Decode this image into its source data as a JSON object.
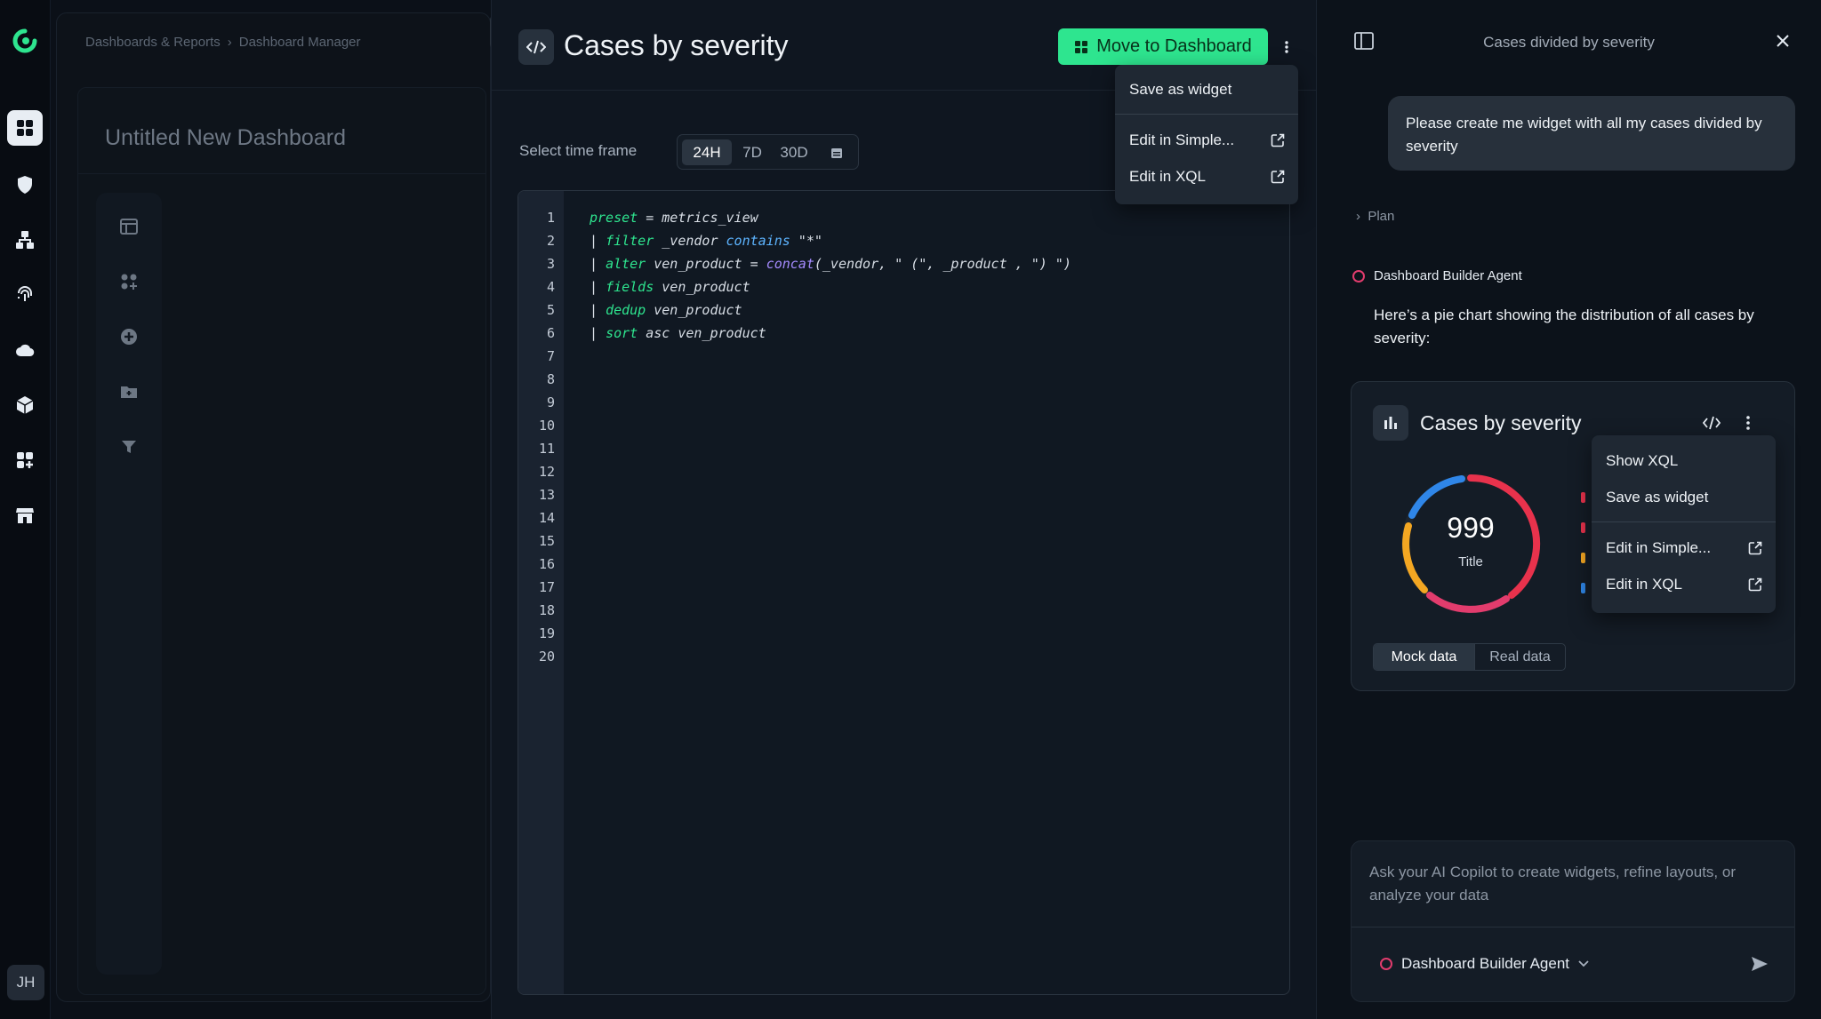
{
  "rail": {
    "items": [
      "dashboards",
      "shield",
      "hierarchy",
      "fingerprint",
      "cloud",
      "cube",
      "add-widgets",
      "marketplace"
    ],
    "avatar": "JH"
  },
  "dashboard": {
    "breadcrumb": [
      "Dashboards & Reports",
      "Dashboard Manager"
    ],
    "title": "Untitled New Dashboard"
  },
  "code_panel": {
    "title": "Cases by severity",
    "move_button": "Move to Dashboard",
    "time_frame_label": "Select time frame",
    "time_frames": [
      "24H",
      "7D",
      "30D"
    ],
    "time_frame_selected": "24H",
    "line_numbers": [
      "1",
      "2",
      "3",
      "4",
      "5",
      "6",
      "7",
      "8",
      "9",
      "10",
      "11",
      "12",
      "13",
      "14",
      "15",
      "16",
      "17",
      "18",
      "19",
      "20"
    ],
    "code": [
      {
        "kw": "preset",
        "rest": " = metrics_view"
      },
      {
        "pipe": "| ",
        "kw": "filter",
        "rest1": " _vendor ",
        "op": "contains",
        "rest2": " \"*\""
      },
      {
        "pipe": "| ",
        "kw": "alter",
        "rest1": " ven_product = ",
        "fn": "concat",
        "rest2": "(_vendor, \" (\", _product , \") \")"
      },
      {
        "pipe": "| ",
        "kw": "fields",
        "rest": " ven_product"
      },
      {
        "pipe": "| ",
        "kw": "dedup",
        "rest": " ven_product"
      },
      {
        "pipe": "| ",
        "kw": "sort",
        "rest": " asc ven_product"
      }
    ],
    "menu": {
      "save": "Save as widget",
      "edit_simple": "Edit in Simple...",
      "edit_xql": "Edit in XQL"
    }
  },
  "chat": {
    "header_title": "Cases divided by severity",
    "user_message": "Please create me widget with all my cases divided by severity",
    "plan_label": "Plan",
    "agent_name": "Dashboard Builder Agent",
    "agent_message": "Here’s a pie chart showing the distribution of all cases by severity:",
    "widget": {
      "title": "Cases by severity",
      "center_value": "999",
      "center_label": "Title",
      "tabs": [
        "Mock data",
        "Real data"
      ],
      "tab_selected": "Mock data",
      "legend_colors": [
        "#e8324c",
        "#e8324c",
        "#f4a722",
        "#2f86e8"
      ],
      "menu": {
        "show_xql": "Show XQL",
        "save": "Save as widget",
        "edit_simple": "Edit in Simple...",
        "edit_xql": "Edit in XQL"
      }
    },
    "composer_placeholder": "Ask your AI Copilot to create widgets, refine layouts, or analyze your data",
    "agent_select": "Dashboard Builder Agent"
  },
  "colors": {
    "accent_green": "#2ee58f",
    "critical": "#e8324c",
    "high": "#e23c6d",
    "medium": "#f4a722",
    "low": "#2f86e8"
  }
}
